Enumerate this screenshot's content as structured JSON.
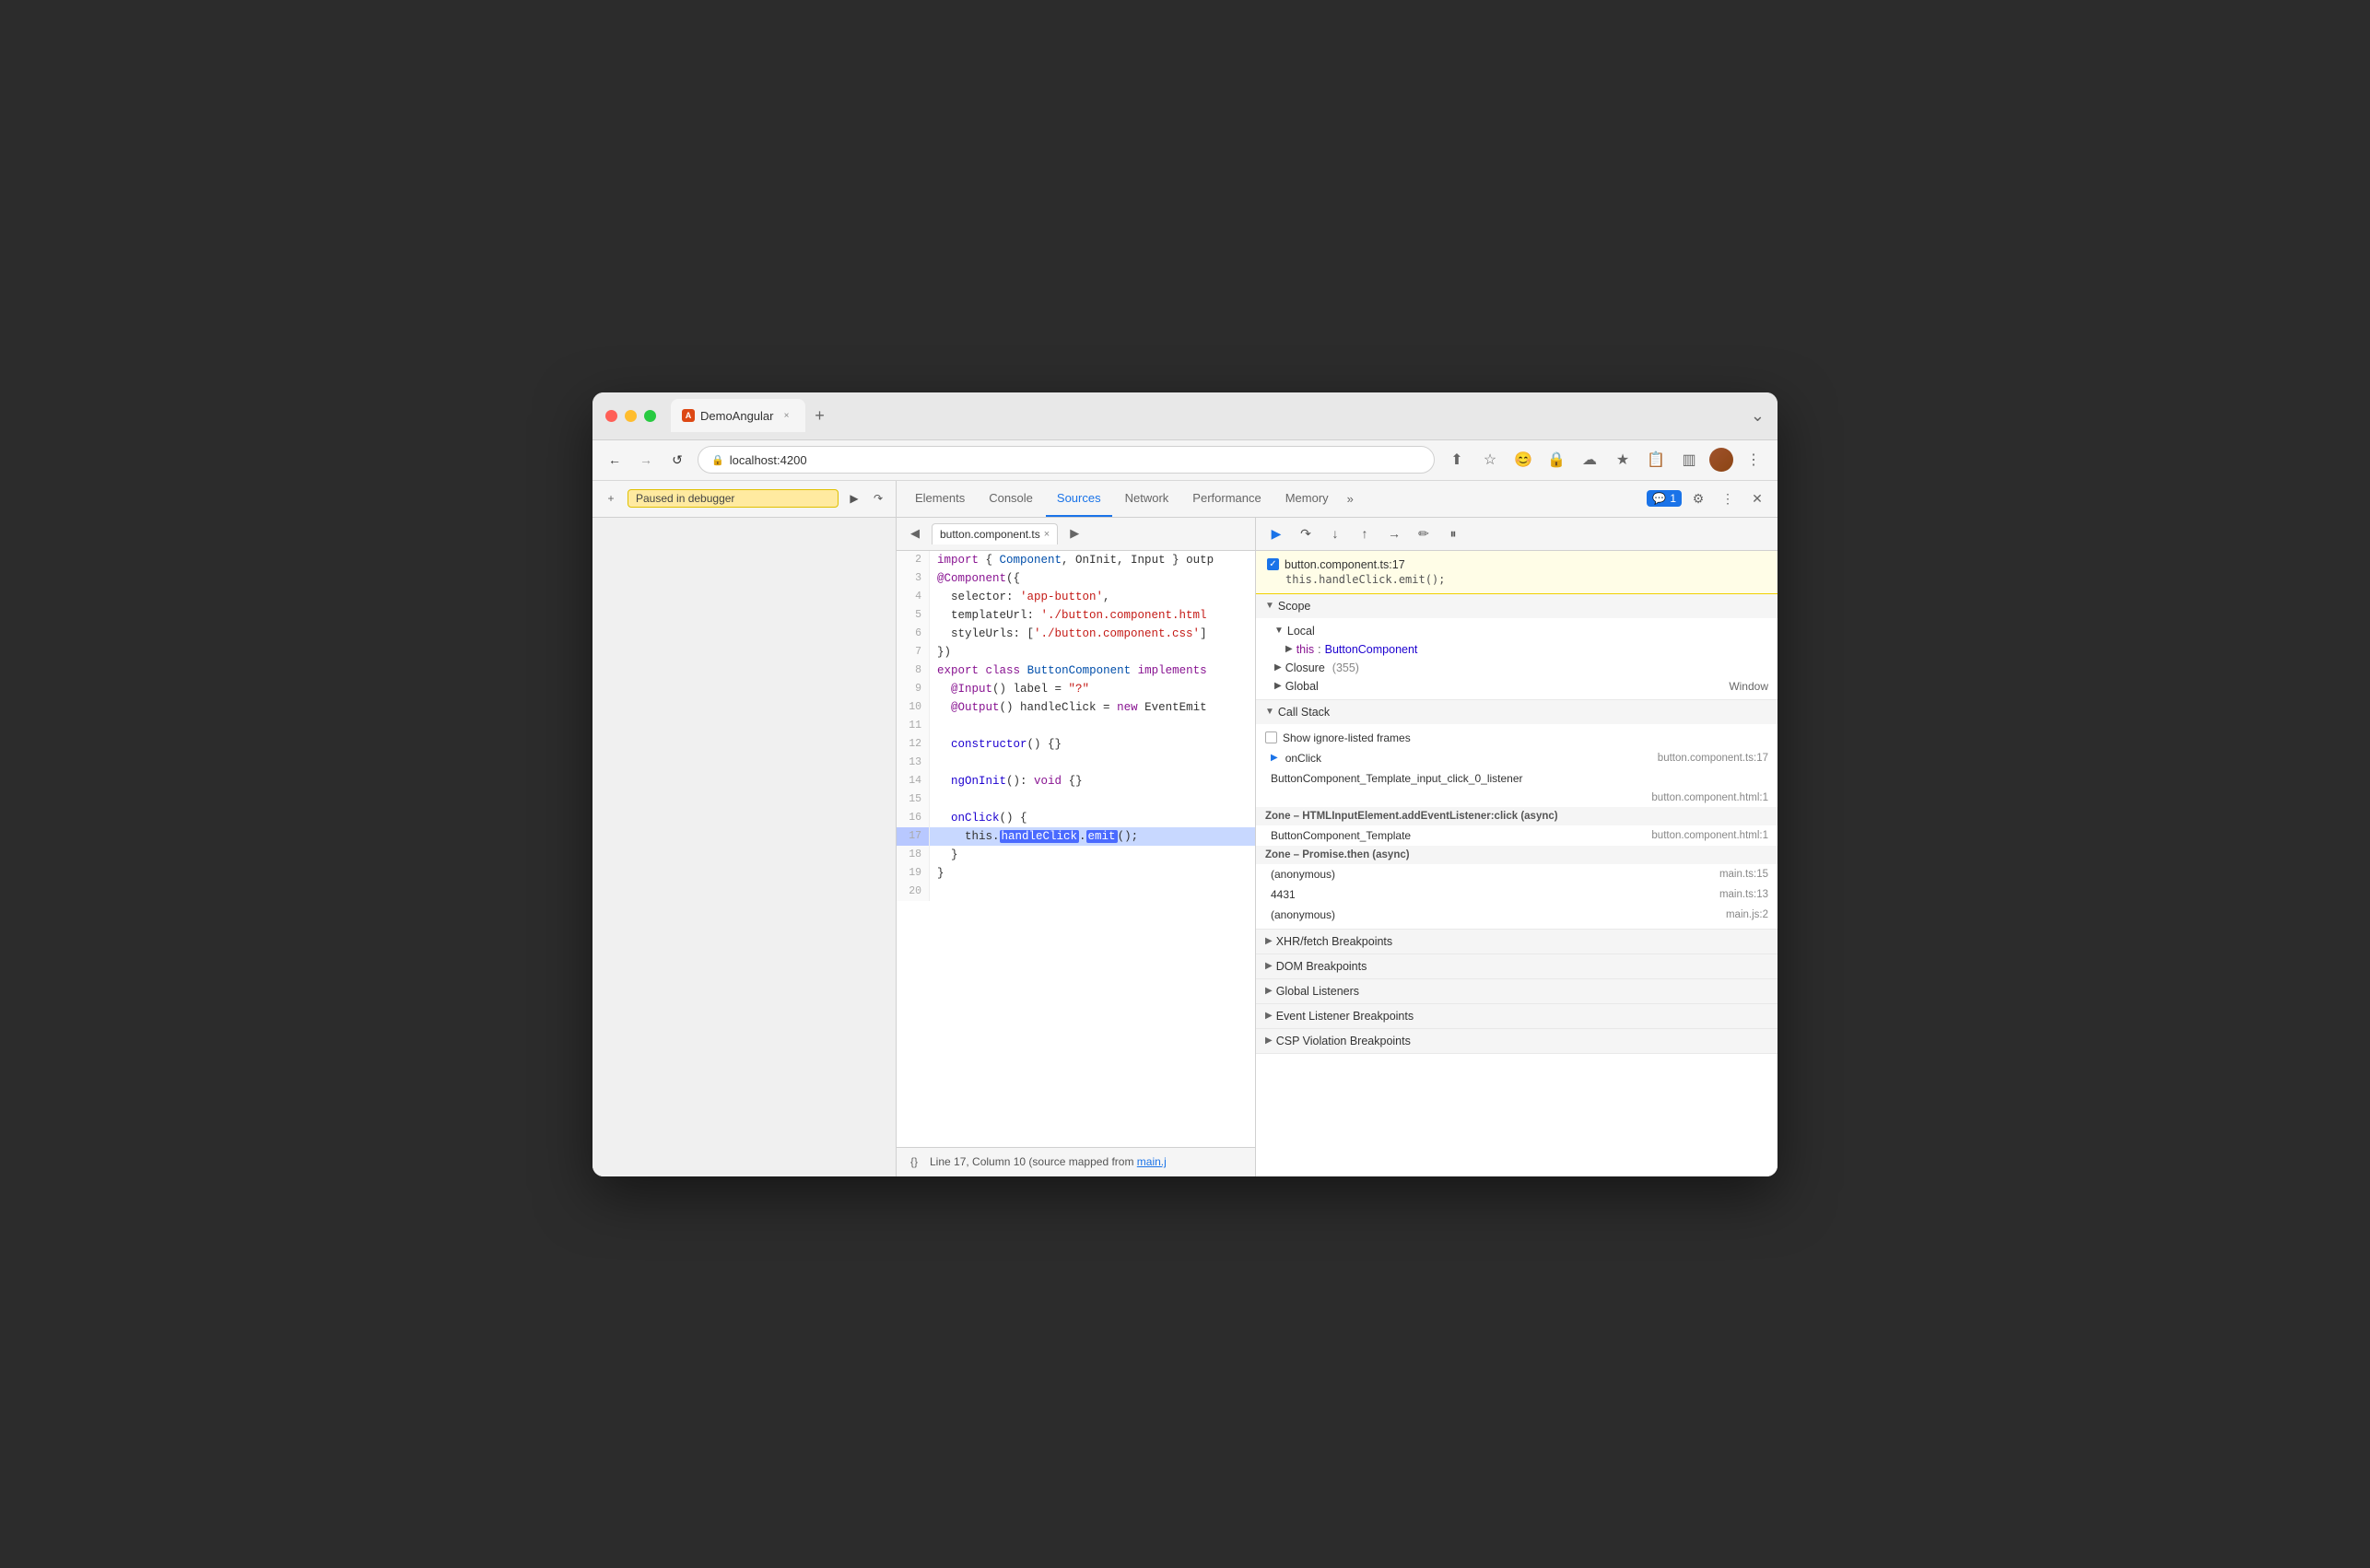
{
  "browser": {
    "tab_title": "DemoAngular",
    "tab_favicon": "A",
    "url": "localhost:4200",
    "new_tab_label": "+",
    "more_label": "⌄"
  },
  "nav": {
    "back": "←",
    "forward": "→",
    "refresh": "↺"
  },
  "toolbar_icons": [
    "⬆",
    "☆",
    "😊",
    "🔒",
    "☁",
    "★",
    "📋",
    "👤",
    "⋮"
  ],
  "page": {
    "plus_btn": "+",
    "paused_text": "Paused in debugger",
    "play_btn": "▶",
    "arrow_right_btn": "↷"
  },
  "devtools": {
    "tabs": [
      "Elements",
      "Console",
      "Sources",
      "Network",
      "Performance",
      "Memory"
    ],
    "active_tab": "Sources",
    "more_label": "»",
    "badge_count": "1",
    "settings_label": "⚙",
    "more_vert_label": "⋮",
    "close_label": "✕"
  },
  "source_file": {
    "filename": "button.component.ts",
    "close_label": "×"
  },
  "debug_controls": {
    "resume": "▶",
    "step_over": "↷",
    "step_into": "↓",
    "step_out": "↑",
    "step": "→→",
    "deactivate": "✏",
    "pause": "⏸"
  },
  "breakpoint": {
    "checked": true,
    "title": "button.component.ts:17",
    "code": "this.handleClick.emit();"
  },
  "code_lines": [
    {
      "num": "2",
      "content": "import { Component, OnInit, Input } outp"
    },
    {
      "num": "3",
      "content": "@Component({"
    },
    {
      "num": "4",
      "content": "  selector: 'app-button',"
    },
    {
      "num": "5",
      "content": "  templateUrl: './button.component.html"
    },
    {
      "num": "6",
      "content": "  styleUrls: ['./button.component.css']"
    },
    {
      "num": "7",
      "content": "})"
    },
    {
      "num": "8",
      "content": "export class ButtonComponent implements"
    },
    {
      "num": "9",
      "content": "  @Input() label = \"?\""
    },
    {
      "num": "10",
      "content": "  @Output() handleClick = new EventEmit"
    },
    {
      "num": "11",
      "content": ""
    },
    {
      "num": "12",
      "content": "  constructor() {}"
    },
    {
      "num": "13",
      "content": ""
    },
    {
      "num": "14",
      "content": "  ngOnInit(): void {}"
    },
    {
      "num": "15",
      "content": ""
    },
    {
      "num": "16",
      "content": "  onClick() {"
    },
    {
      "num": "17",
      "content": "    this.handleClick.emit();",
      "active": true
    },
    {
      "num": "18",
      "content": "  }"
    },
    {
      "num": "19",
      "content": "}"
    },
    {
      "num": "20",
      "content": ""
    }
  ],
  "status_bar": {
    "brace_icon": "{}",
    "text": "Line 17, Column 10 (source mapped from ",
    "link": "main.j",
    "text2": ""
  },
  "scope": {
    "header": "Scope",
    "local_header": "Local",
    "this_label": "this",
    "this_value": "ButtonComponent",
    "closure_header": "Closure",
    "closure_count": "355",
    "global_header": "Global",
    "global_value": "Window"
  },
  "call_stack": {
    "header": "Call Stack",
    "show_ignored": "Show ignore-listed frames",
    "items": [
      {
        "name": "onClick",
        "file": "button.component.ts:17",
        "arrow": true
      },
      {
        "name": "ButtonComponent_Template_input_click_0_listener",
        "file": "",
        "arrow": false
      },
      {
        "name": "",
        "file": "button.component.html:1",
        "arrow": false,
        "indent": true
      }
    ],
    "async_zones": [
      {
        "label": "Zone – HTMLInputElement.addEventListener:click (async)",
        "items": [
          {
            "name": "ButtonComponent_Template",
            "file": "button.component.html:1"
          }
        ]
      },
      {
        "label": "Zone – Promise.then (async)",
        "items": [
          {
            "name": "(anonymous)",
            "file": "main.ts:15"
          },
          {
            "name": "4431",
            "file": "main.ts:13"
          },
          {
            "name": "(anonymous)",
            "file": "main.js:2"
          }
        ]
      }
    ]
  },
  "breakpoints_panels": [
    {
      "label": "XHR/fetch Breakpoints",
      "expanded": false
    },
    {
      "label": "DOM Breakpoints",
      "expanded": false
    },
    {
      "label": "Global Listeners",
      "expanded": false
    },
    {
      "label": "Event Listener Breakpoints",
      "expanded": false
    },
    {
      "label": "CSP Violation Breakpoints",
      "expanded": false
    }
  ]
}
